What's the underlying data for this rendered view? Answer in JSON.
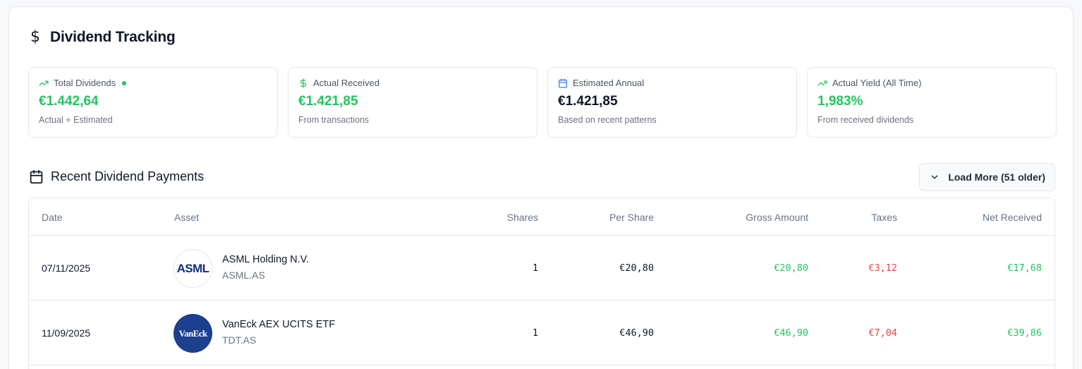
{
  "header": {
    "title": "Dividend Tracking",
    "icon": "dollar-icon"
  },
  "stats": [
    {
      "label": "Total Dividends",
      "value": "€1.442,64",
      "sub": "Actual + Estimated",
      "icon": "trending-up-icon",
      "value_color": "#22c55e"
    },
    {
      "label": "Actual Received",
      "value": "€1.421,85",
      "sub": "From transactions",
      "icon": "dollar-icon",
      "value_color": "#22c55e"
    },
    {
      "label": "Estimated Annual",
      "value": "€1.421,85",
      "sub": "Based on recent patterns",
      "icon": "calendar-icon",
      "value_color": "#0f172a"
    },
    {
      "label": "Actual Yield (All Time)",
      "value": "1,983%",
      "sub": "From received dividends",
      "icon": "trending-up-icon",
      "value_color": "#22c55e"
    }
  ],
  "recent": {
    "title": "Recent Dividend Payments",
    "load_more_label": "Load More (51 older)"
  },
  "table": {
    "columns": [
      "Date",
      "Asset",
      "Shares",
      "Per Share",
      "Gross Amount",
      "Taxes",
      "Net Received"
    ],
    "rows": [
      {
        "date": "07/11/2025",
        "logo": "ASML",
        "name": "ASML Holding N.V.",
        "symbol": "ASML.AS",
        "shares": "1",
        "per_share": "€20,80",
        "gross": "€20,80",
        "taxes": "€3,12",
        "net": "€17,68"
      },
      {
        "date": "11/09/2025",
        "logo": "VanEck",
        "name": "VanEck AEX UCITS ETF",
        "symbol": "TDT.AS",
        "shares": "1",
        "per_share": "€46,90",
        "gross": "€46,90",
        "taxes": "€7,04",
        "net": "€39,86"
      }
    ]
  },
  "colors": {
    "positive": "#22c55e",
    "negative": "#ef4444",
    "calendar_accent": "#3b82f6"
  }
}
